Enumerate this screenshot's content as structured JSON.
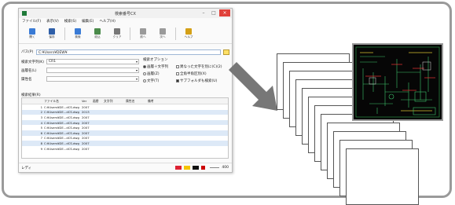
{
  "window": {
    "title": "検索番号CX",
    "controls": [
      "–",
      "□",
      "×"
    ]
  },
  "menubar": {
    "items": [
      "ファイル(F)",
      "表示(V)",
      "検索(S)",
      "編集(E)",
      "ヘルプ(H)"
    ]
  },
  "toolbar": {
    "buttons": [
      {
        "label": "開く",
        "icon": "folder-icon",
        "color": "#3a7bd5"
      },
      {
        "label": "保存",
        "icon": "save-icon",
        "color": "#2f5fa8"
      },
      {
        "label": "検索",
        "icon": "search-document-icon",
        "color": "#3a7bd5"
      },
      {
        "label": "絞込",
        "icon": "filter-icon",
        "color": "#4a8a4a"
      },
      {
        "label": "クリア",
        "icon": "text-icon",
        "color": "#777777"
      },
      {
        "label": "前へ",
        "icon": "grid-icon",
        "color": "#9a9a9a"
      },
      {
        "label": "次へ",
        "icon": "grid-icon",
        "color": "#9a9a9a"
      },
      {
        "label": "ヘルプ",
        "icon": "help-icon",
        "color": "#d4a017"
      }
    ]
  },
  "path": {
    "label": "パス(P)",
    "value": "C:¥Users¥DEW¥"
  },
  "fields": [
    {
      "label": "検索文字列(K)",
      "value": "CR1"
    },
    {
      "label": "画層名(L)",
      "value": ""
    },
    {
      "label": "属性名",
      "value": ""
    }
  ],
  "options": {
    "title": "検索オプション",
    "items": [
      {
        "type": "radio",
        "label": "画層＋文字列",
        "checked": true
      },
      {
        "type": "check",
        "label": "異なった文字を別に(C)(2)",
        "checked": false
      },
      {
        "type": "radio",
        "label": "画層(Z)",
        "checked": false
      },
      {
        "type": "check",
        "label": "全角半角区別(X)",
        "checked": false
      },
      {
        "type": "radio",
        "label": "文字(T)",
        "checked": false
      },
      {
        "type": "check",
        "label": "サブフォルダも検索(U)",
        "checked": true
      }
    ]
  },
  "results": {
    "label": "検索結果(R)",
    "columns": [
      "",
      "ファイル名",
      "Ver",
      "画層",
      "文字列",
      "属性名",
      "備考"
    ],
    "rows": [
      {
        "no": "1",
        "file": "C:¥Users¥DE...dCS.dwg",
        "ver": "2007"
      },
      {
        "no": "2",
        "file": "C:¥Users¥DE...dCS.dwg",
        "ver": "2013"
      },
      {
        "no": "3",
        "file": "C:¥Users¥DE...dCS.dwg",
        "ver": "2007"
      },
      {
        "no": "4",
        "file": "C:¥Users¥DE...dCS.dwg",
        "ver": "2007"
      },
      {
        "no": "5",
        "file": "C:¥Users¥DE...dCS.dwg",
        "ver": "2007"
      },
      {
        "no": "6",
        "file": "C:¥Users¥DE...dCS.dwg",
        "ver": "2007"
      },
      {
        "no": "7",
        "file": "C:¥Users¥DE...dCS.dwg",
        "ver": "2007"
      },
      {
        "no": "8",
        "file": "C:¥Users¥DE...dCS.dwg",
        "ver": "2007"
      },
      {
        "no": "9",
        "file": "C:¥Users¥DE...dCS.dwg",
        "ver": "2007"
      }
    ]
  },
  "status": {
    "text": "レディ",
    "zoom": "400"
  }
}
